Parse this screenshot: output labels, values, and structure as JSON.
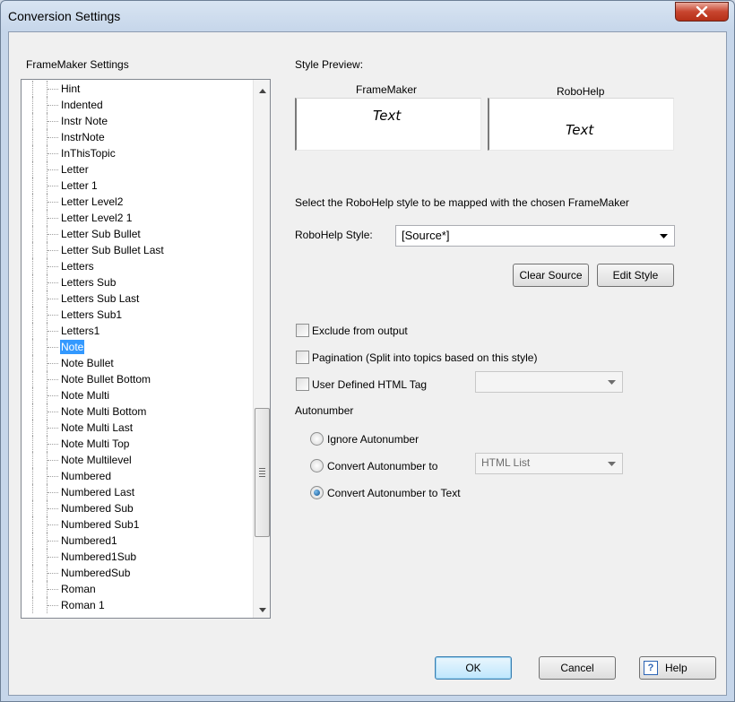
{
  "window": {
    "title": "Conversion Settings"
  },
  "left_panel": {
    "heading": "FrameMaker Settings",
    "items": [
      "Hint",
      "Indented",
      "Instr Note",
      "InstrNote",
      "InThisTopic",
      "Letter",
      "Letter 1",
      "Letter Level2",
      "Letter Level2 1",
      "Letter Sub Bullet",
      "Letter Sub Bullet Last",
      "Letters",
      "Letters Sub",
      "Letters Sub Last",
      "Letters Sub1",
      "Letters1",
      "Note",
      "Note Bullet",
      "Note Bullet Bottom",
      "Note Multi",
      "Note Multi Bottom",
      "Note Multi Last",
      "Note Multi Top",
      "Note Multilevel",
      "Numbered",
      "Numbered Last",
      "Numbered Sub",
      "Numbered Sub1",
      "Numbered1",
      "Numbered1Sub",
      "NumberedSub",
      "Roman",
      "Roman 1"
    ],
    "selected": "Note"
  },
  "style_preview": {
    "heading": "Style Preview:",
    "framemaker_label": "FrameMaker",
    "robohelp_label": "RoboHelp",
    "framemaker_text": "Text",
    "robohelp_text": "Text"
  },
  "mapping": {
    "instruction": "Select the RoboHelp style to be mapped with the chosen FrameMaker",
    "style_label": "RoboHelp Style:",
    "style_value": "[Source*]",
    "clear_source_label": "Clear Source",
    "edit_style_label": "Edit Style"
  },
  "options": {
    "exclude_label": "Exclude from output",
    "exclude_checked": false,
    "pagination_label": "Pagination (Split into topics based on this style)",
    "pagination_checked": false,
    "user_html_tag_label": "User Defined HTML Tag",
    "user_html_tag_checked": false,
    "user_html_tag_value": ""
  },
  "autonumber": {
    "heading": "Autonumber",
    "ignore_label": "Ignore Autonumber",
    "convert_label": "Convert Autonumber to",
    "convert_value": "HTML List",
    "convert_text_label": "Convert Autonumber to Text",
    "selected": "convert_text"
  },
  "footer": {
    "ok_label": "OK",
    "cancel_label": "Cancel",
    "help_label": "Help",
    "help_icon_glyph": "?"
  }
}
